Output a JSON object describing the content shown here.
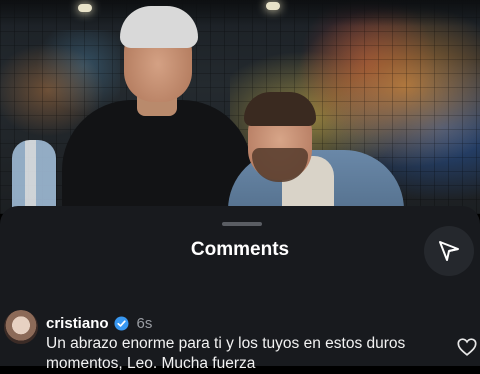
{
  "photo": {
    "alt_subject": ""
  },
  "comments_sheet": {
    "title": "Comments",
    "share_icon": "paper-plane-icon"
  },
  "comment": {
    "username": "cristiano",
    "verified_icon": "verified-badge-icon",
    "time": "6s",
    "text": "Un abrazo enorme para ti y los tuyos en estos duros momentos, Leo. Mucha fuerza",
    "like_icon": "heart-outline-icon"
  },
  "colors": {
    "sheet_bg": "#181a1e",
    "verified_blue": "#3897f0",
    "text_primary": "#ffffff",
    "text_secondary": "#9a9da3"
  }
}
